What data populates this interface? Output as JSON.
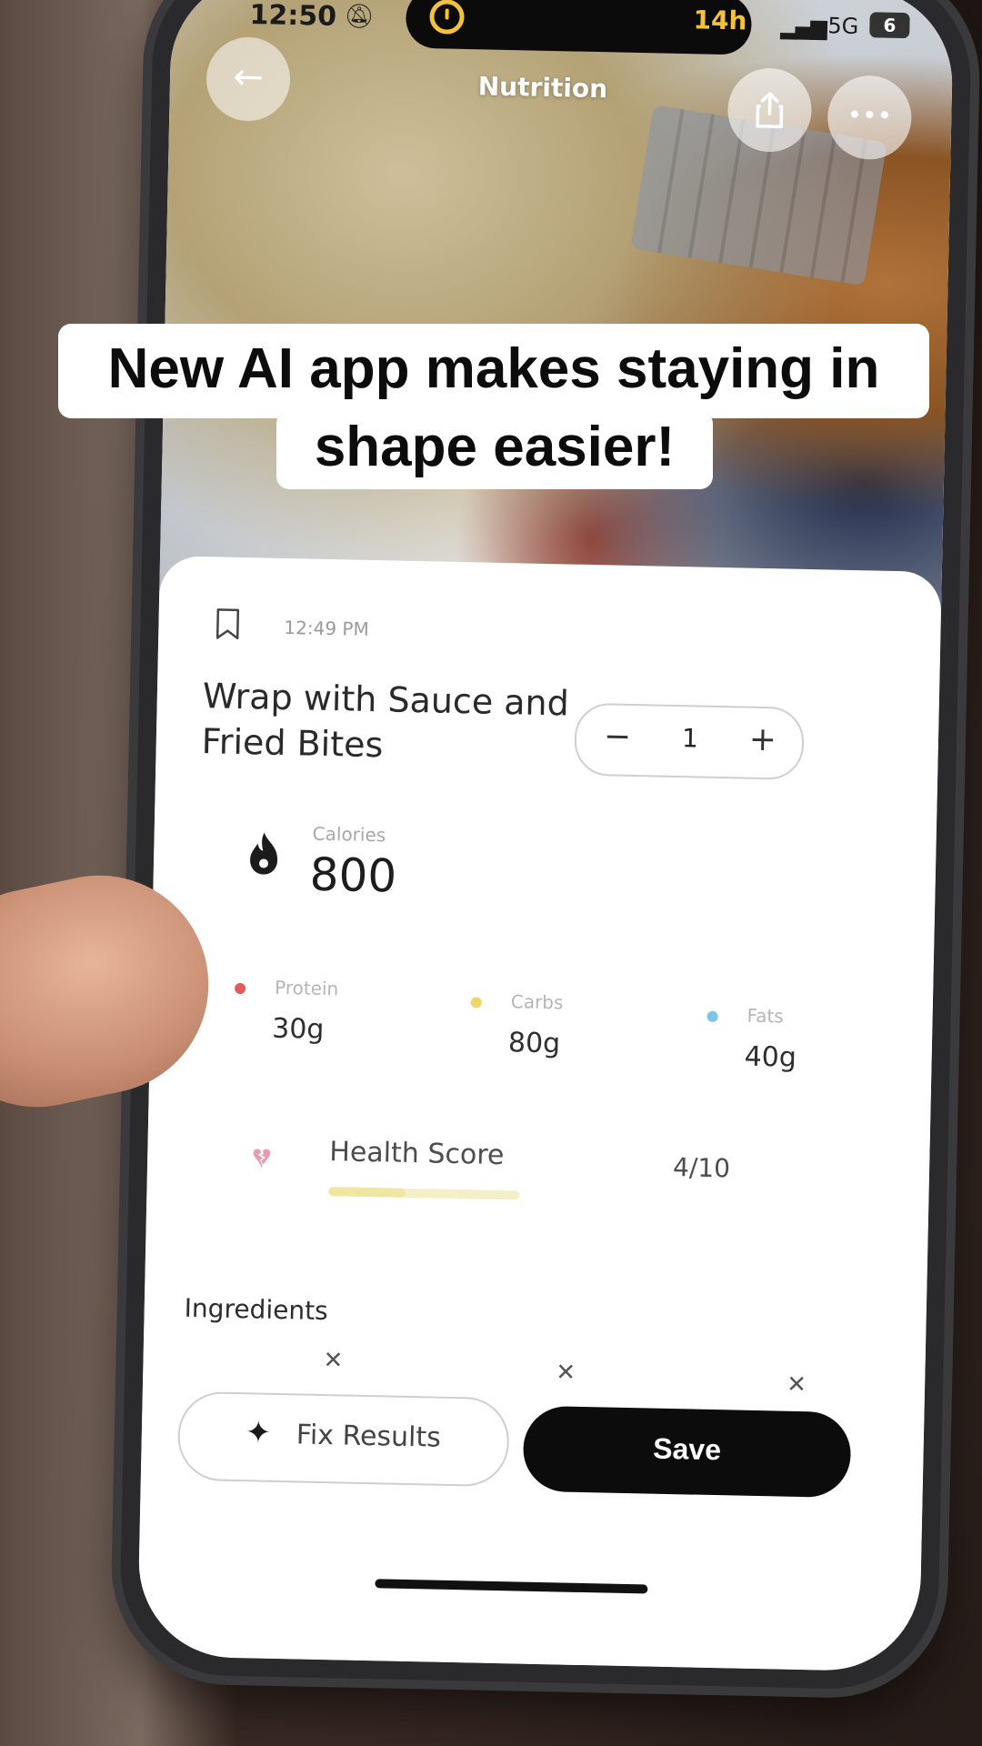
{
  "status_bar": {
    "time": "12:50",
    "island_text": "14h",
    "network": "5G",
    "battery": "6"
  },
  "nav": {
    "title": "Nutrition"
  },
  "caption": {
    "line1": "New AI app makes staying in",
    "line2": "shape easier!"
  },
  "meal": {
    "timestamp": "12:49 PM",
    "name_line1": "Wrap with Sauce and",
    "name_line2": "Fried Bites",
    "quantity": "1"
  },
  "calories": {
    "label": "Calories",
    "value": "800"
  },
  "macros": [
    {
      "label": "Protein",
      "value": "30g",
      "color": "#e25a5a"
    },
    {
      "label": "Carbs",
      "value": "80g",
      "color": "#f0d56a"
    },
    {
      "label": "Fats",
      "value": "40g",
      "color": "#7ec4e8"
    }
  ],
  "health_score": {
    "label": "Health Score",
    "value": "4/10",
    "fraction": 0.4
  },
  "ingredients": {
    "title": "Ingredients"
  },
  "actions": {
    "fix_label": "Fix Results",
    "save_label": "Save"
  },
  "icons": {
    "back": "arrow-left-icon",
    "share": "share-icon",
    "more": "more-icon",
    "bookmark": "bookmark-icon",
    "flame": "flame-icon",
    "heart": "broken-heart-icon",
    "sparkle": "sparkle-icon",
    "remove": "close-icon"
  }
}
